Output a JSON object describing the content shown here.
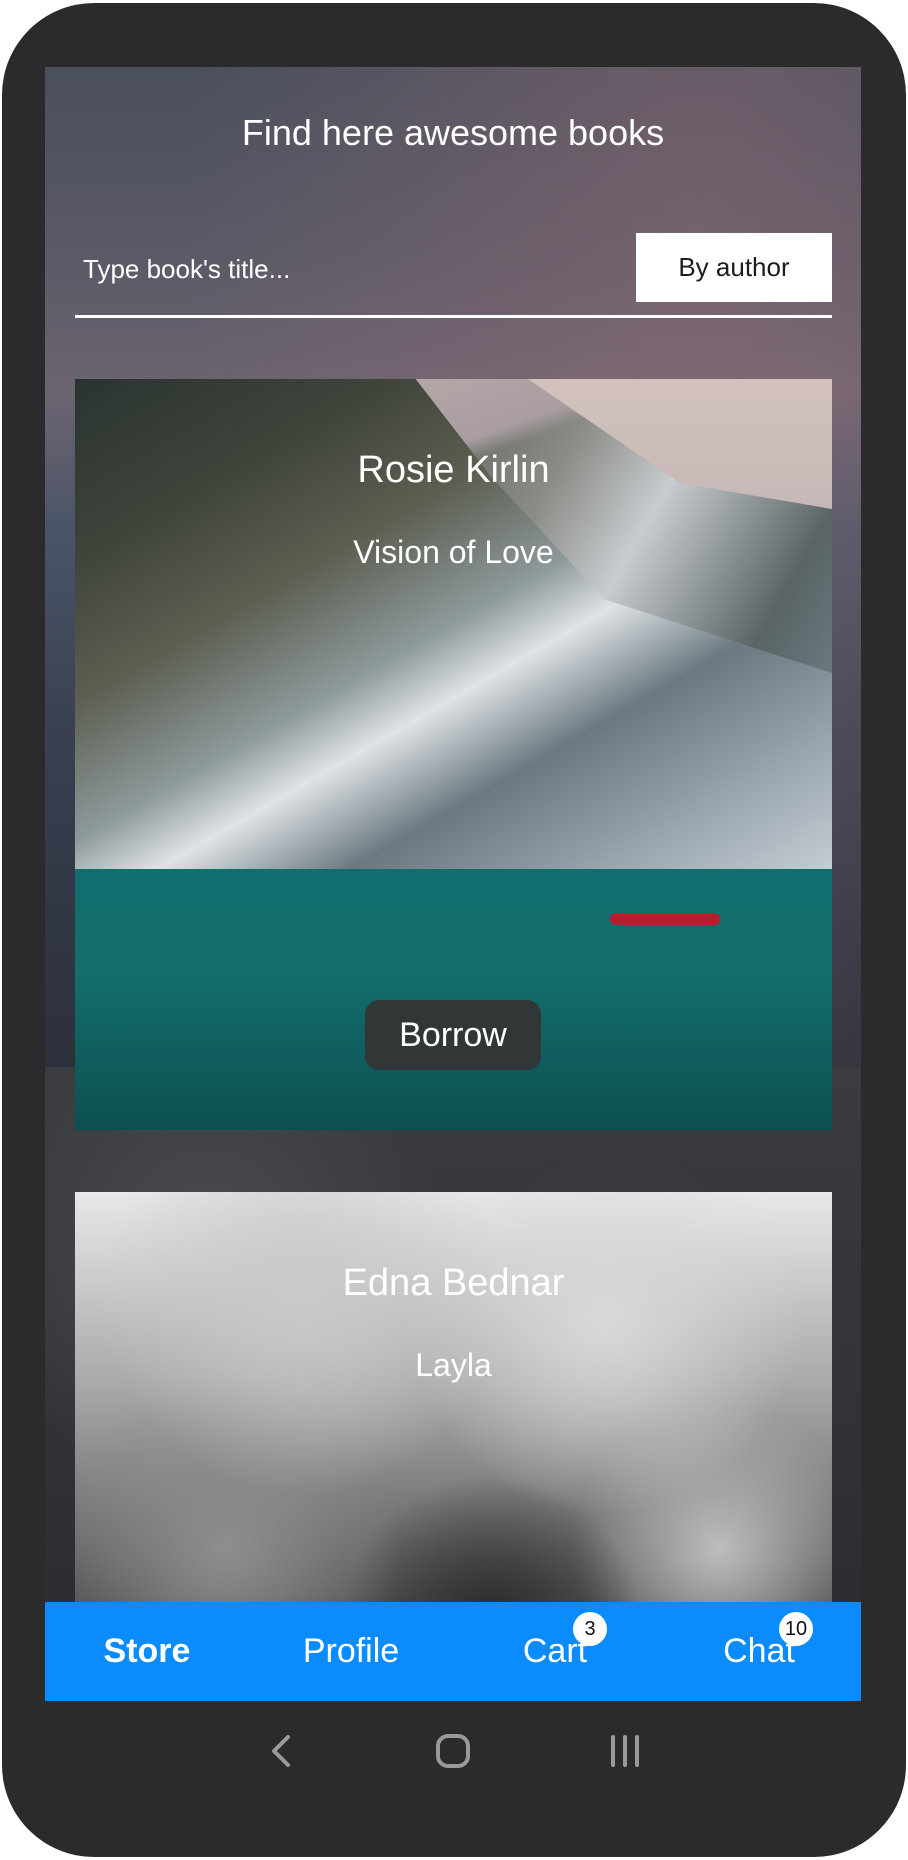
{
  "header": {
    "title": "Find here awesome books"
  },
  "search": {
    "placeholder": "Type book's title...",
    "value": "",
    "mode_button_label": "By author"
  },
  "books": [
    {
      "author": "Rosie Kirlin",
      "title": "Vision of Love",
      "action_label": "Borrow"
    },
    {
      "author": "Edna Bednar",
      "title": "Layla"
    }
  ],
  "tabs": [
    {
      "label": "Store",
      "active": true
    },
    {
      "label": "Profile",
      "active": false
    },
    {
      "label": "Cart",
      "badge": "3",
      "active": false
    },
    {
      "label": "Chat",
      "badge": "10",
      "active": false
    }
  ],
  "system_nav": {
    "icons": [
      "back-icon",
      "home-icon",
      "recents-icon"
    ]
  },
  "colors": {
    "tab_bar": "#0a8cff",
    "frame": "#2b2b2d",
    "borrow_button": "#343434"
  }
}
